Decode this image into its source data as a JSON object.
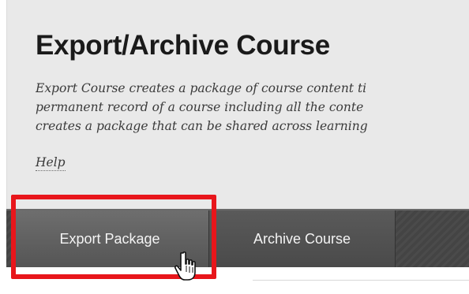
{
  "header": {
    "title": "Export/Archive Course",
    "description_lines": [
      "Export Course creates a package of course content ti",
      "permanent record of a course including all the conte",
      "creates a package that can be shared across learning"
    ],
    "help_link": "Help"
  },
  "tabs": [
    {
      "label": "Export Package",
      "active": true
    },
    {
      "label": "Archive Course",
      "active": false
    }
  ],
  "annotation": {
    "highlight_color": "#e8161b",
    "cursor_icon": "hand-pointer-icon"
  },
  "colors": {
    "header_bg": "#e9e9e9",
    "tab_bar_bg": "#444444"
  }
}
